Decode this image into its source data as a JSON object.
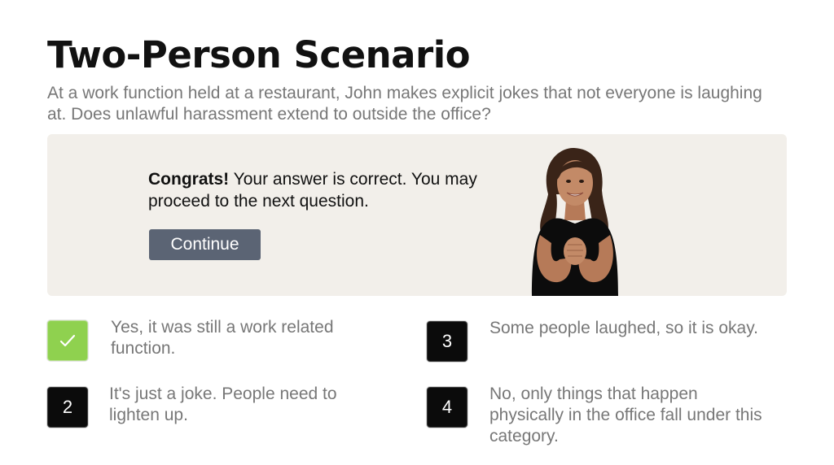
{
  "title": "Two-Person Scenario",
  "question": "At a work function held at a restaurant, John makes explicit jokes that not everyone is laughing at. Does unlawful harassment extend to outside the office?",
  "feedback": {
    "congrats": "Congrats!",
    "message": " Your answer is correct. You may proceed to the next question.",
    "continue_label": "Continue"
  },
  "options": [
    {
      "marker": "",
      "state": "selected-correct",
      "icon": "check-icon",
      "label": "Yes, it was still a work related function."
    },
    {
      "marker": "2",
      "state": "default",
      "label": "It's just a joke. People need to lighten up."
    },
    {
      "marker": "3",
      "state": "default",
      "label": "Some people laughed, so it is okay."
    },
    {
      "marker": "4",
      "state": "default",
      "label": "No, only things that happen physically in the office fall under this category."
    }
  ],
  "colors": {
    "panel_bg": "#f2efea",
    "button_bg": "#5b6474",
    "correct": "#8fd14f",
    "marker_dark": "#0b0b0b",
    "question_text": "#777777"
  }
}
